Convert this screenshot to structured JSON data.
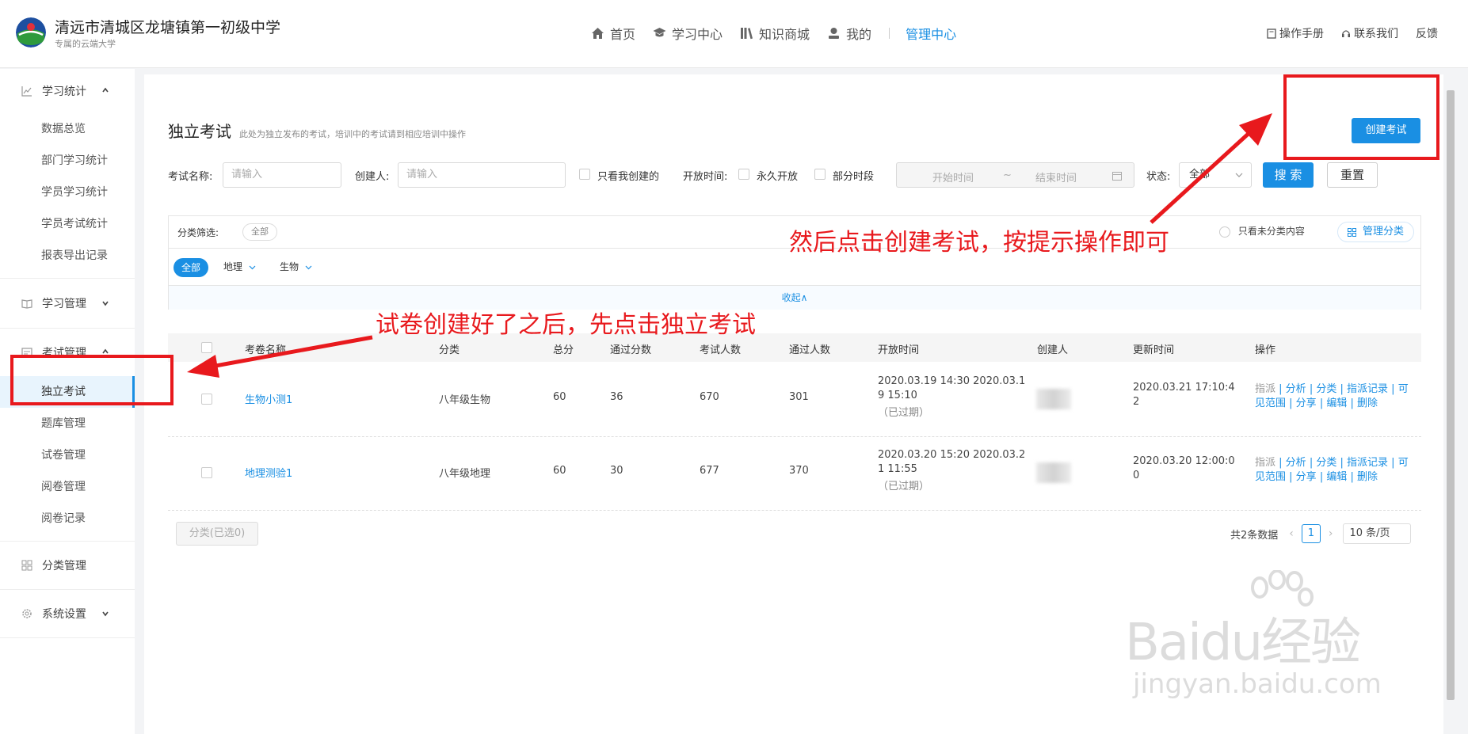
{
  "header": {
    "school_name": "清远市清城区龙塘镇第一初级中学",
    "slogan": "专属的云端大学",
    "nav": [
      "首页",
      "学习中心",
      "知识商城",
      "我的",
      "管理中心"
    ],
    "links": [
      "操作手册",
      "联系我们",
      "反馈"
    ]
  },
  "sidebar": {
    "groups": [
      {
        "label": "学习统计",
        "items": [
          "数据总览",
          "部门学习统计",
          "学员学习统计",
          "学员考试统计",
          "报表导出记录"
        ]
      },
      {
        "label": "学习管理"
      },
      {
        "label": "考试管理",
        "items": [
          "独立考试",
          "题库管理",
          "试卷管理",
          "阅卷管理",
          "阅卷记录"
        ]
      },
      {
        "label": "分类管理"
      },
      {
        "label": "系统设置"
      }
    ]
  },
  "page": {
    "title": "独立考试",
    "description": "此处为独立发布的考试，培训中的考试请到相应培训中操作",
    "create_button": "创建考试"
  },
  "filters": {
    "exam_name_label": "考试名称:",
    "exam_name_placeholder": "请输入",
    "creator_label": "创建人:",
    "creator_placeholder": "请输入",
    "only_mine": "只看我创建的",
    "open_time_label": "开放时间:",
    "forever_open": "永久开放",
    "partial_time": "部分时段",
    "start_time": "开始时间",
    "range_sep": "~",
    "end_time": "结束时间",
    "status_label": "状态:",
    "status_value": "全部",
    "search": "搜 索",
    "reset": "重置"
  },
  "category_filter": {
    "label": "分类筛选:",
    "selected_tag": "全部",
    "only_uncategorized": "只看未分类内容",
    "manage": "管理分类",
    "all": "全部",
    "categories": [
      "地理",
      "生物"
    ],
    "collapse": "收起∧"
  },
  "table": {
    "columns": [
      "考卷名称",
      "分类",
      "总分",
      "通过分数",
      "考试人数",
      "通过人数",
      "开放时间",
      "创建人",
      "更新时间",
      "操作"
    ],
    "rows": [
      {
        "name": "生物小测1",
        "category": "八年级生物",
        "total": "60",
        "pass": "36",
        "examinees": "670",
        "passed": "301",
        "open_line1": "2020.03.19 14:30 2020.03.1",
        "open_line2": "9 15:10",
        "open_status": "（已过期）",
        "updated_line1": "2020.03.21 17:10:4",
        "updated_line2": "2"
      },
      {
        "name": "地理测验1",
        "category": "八年级地理",
        "total": "60",
        "pass": "30",
        "examinees": "677",
        "passed": "370",
        "open_line1": "2020.03.20 15:20 2020.03.2",
        "open_line2": "1 11:55",
        "open_status": "（已过期）",
        "updated_line1": "2020.03.20 12:00:0",
        "updated_line2": "0"
      }
    ],
    "ops_line1": [
      "指派",
      "分析",
      "分类",
      "指派记录",
      "可"
    ],
    "ops_line2": [
      "见范围",
      "分享",
      "编辑",
      "删除"
    ],
    "ops_sep": " | "
  },
  "footer": {
    "bulk_category": "分类(已选0)",
    "total_text": "共2条数据",
    "current_page": "1",
    "page_size": "10 条/页"
  },
  "annotations": {
    "step1": "试卷创建好了之后，先点击独立考试",
    "step2": "然后点击创建考试，按提示操作即可",
    "color": "#e8191d"
  },
  "watermark": {
    "brand": "Baidu经验",
    "url": "jingyan.baidu.com"
  },
  "colors": {
    "accent": "#1a8fe3"
  }
}
